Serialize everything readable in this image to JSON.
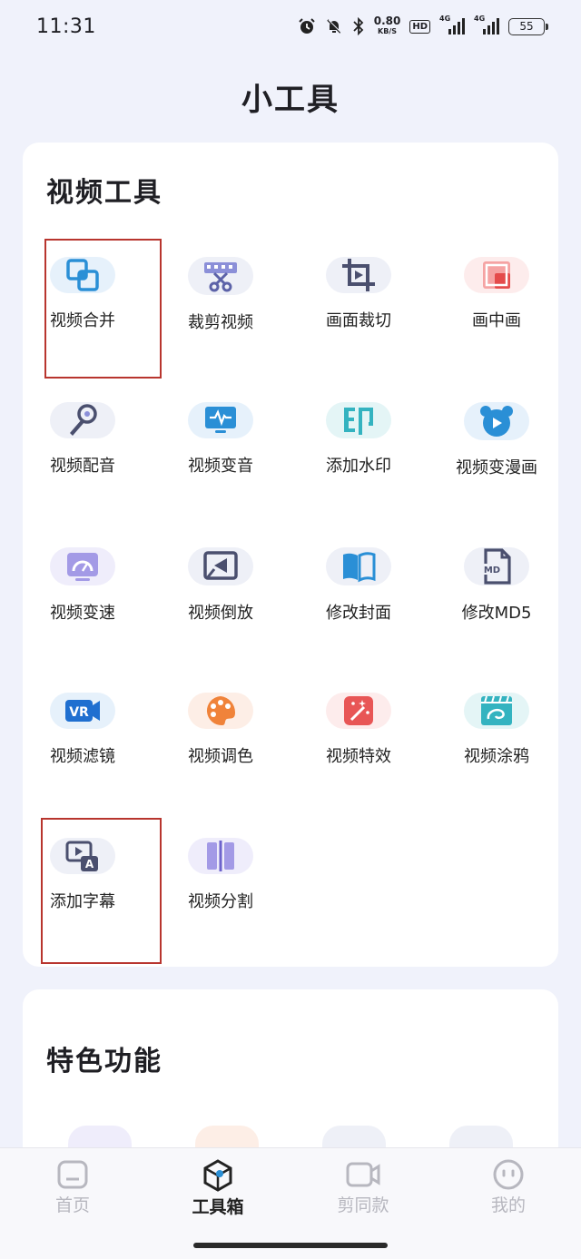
{
  "status": {
    "time": "11:31",
    "net_speed": "0.80",
    "net_unit": "KB/S",
    "hd": "HD",
    "signal1": "4G",
    "signal2": "4G",
    "battery": "55"
  },
  "page": {
    "title": "小工具"
  },
  "video_tools": {
    "title": "视频工具",
    "items": [
      {
        "label": "视频合并",
        "icon": "merge-icon"
      },
      {
        "label": "裁剪视频",
        "icon": "cut-video-icon"
      },
      {
        "label": "画面裁切",
        "icon": "crop-icon"
      },
      {
        "label": "画中画",
        "icon": "picture-in-picture-icon"
      },
      {
        "label": "视频配音",
        "icon": "microphone-icon"
      },
      {
        "label": "视频变音",
        "icon": "voice-change-icon"
      },
      {
        "label": "添加水印",
        "icon": "watermark-icon"
      },
      {
        "label": "视频变漫画",
        "icon": "cartoon-icon"
      },
      {
        "label": "视频变速",
        "icon": "speedometer-icon"
      },
      {
        "label": "视频倒放",
        "icon": "reverse-icon"
      },
      {
        "label": "修改封面",
        "icon": "book-cover-icon"
      },
      {
        "label": "修改MD5",
        "icon": "md5-file-icon"
      },
      {
        "label": "视频滤镜",
        "icon": "vr-filter-icon"
      },
      {
        "label": "视频调色",
        "icon": "palette-icon"
      },
      {
        "label": "视频特效",
        "icon": "magic-wand-icon"
      },
      {
        "label": "视频涂鸦",
        "icon": "graffiti-icon"
      },
      {
        "label": "添加字幕",
        "icon": "subtitle-icon"
      },
      {
        "label": "视频分割",
        "icon": "split-icon"
      }
    ]
  },
  "features": {
    "title": "特色功能"
  },
  "tabbar": {
    "tabs": [
      {
        "label": "首页",
        "icon": "home-icon"
      },
      {
        "label": "工具箱",
        "icon": "toolbox-icon"
      },
      {
        "label": "剪同款",
        "icon": "video-camera-icon"
      },
      {
        "label": "我的",
        "icon": "profile-icon"
      }
    ]
  }
}
